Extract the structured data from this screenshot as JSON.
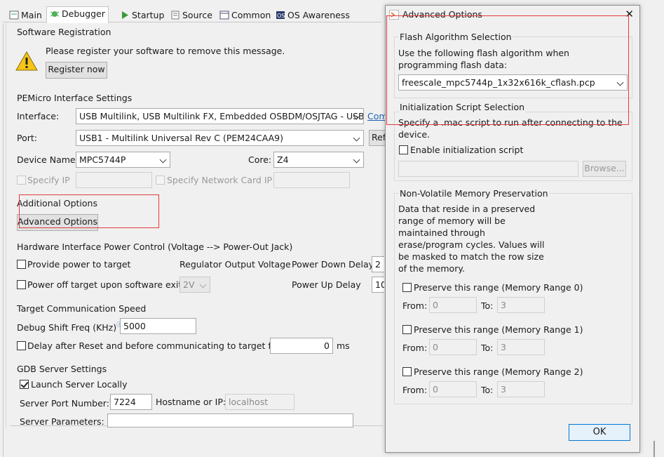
{
  "tabs": [
    {
      "label": "Main",
      "icon": "main-tab-icon"
    },
    {
      "label": "Debugger",
      "icon": "debugger-tab-icon"
    },
    {
      "label": "Startup",
      "icon": "startup-tab-icon"
    },
    {
      "label": "Source",
      "icon": "source-tab-icon"
    },
    {
      "label": "Common",
      "icon": "common-tab-icon"
    },
    {
      "label": "OS Awareness",
      "icon": "os-awareness-tab-icon"
    }
  ],
  "registration": {
    "title": "Software Registration",
    "message": "Please register your software to remove this message.",
    "button": "Register now"
  },
  "pemicro": {
    "title": "PEMicro Interface Settings",
    "interface_label": "Interface:",
    "interface_value": "USB Multilink, USB Multilink FX, Embedded OSBDM/OSJTAG - USB",
    "compare_link": "Com",
    "port_label": "Port:",
    "port_value": "USB1 - Multilink Universal Rev C (PEM24CAA9)",
    "refresh_button": "Ref",
    "device_label": "Device Name:",
    "device_value": "MPC5744P",
    "core_label": "Core:",
    "core_value": "Z4",
    "specify_ip_label": "Specify IP",
    "specify_nic_label": "Specify Network Card IP"
  },
  "additional": {
    "title": "Additional Options",
    "button": "Advanced Options"
  },
  "power": {
    "title": "Hardware Interface Power Control (Voltage --> Power-Out Jack)",
    "provide_power_label": "Provide power to target",
    "regulator_label": "Regulator Output Voltage",
    "power_down_label": "Power Down Delay",
    "power_down_value": "2",
    "power_off_label": "Power off target upon software exit",
    "voltage_value": "2V",
    "power_up_label": "Power Up Delay",
    "power_up_value": "10"
  },
  "speed": {
    "title": "Target Communication Speed",
    "shift_label": "Debug Shift Freq (KHz)",
    "shift_value": "5000",
    "delay_label": "Delay after Reset and before communicating to target for",
    "delay_value": "0",
    "delay_unit": "ms"
  },
  "gdb": {
    "title": "GDB Server Settings",
    "launch_label": "Launch Server Locally",
    "port_label": "Server Port Number:",
    "port_value": "7224",
    "hostname_label": "Hostname or IP:",
    "hostname_value": "localhost",
    "params_label": "Server Parameters:"
  },
  "dialog": {
    "title": "Advanced Options",
    "close": "✕",
    "flash": {
      "title": "Flash Algorithm Selection",
      "desc_line1": "Use the following flash algorithm when",
      "desc_line2": "programming flash data:",
      "algorithm_value": "freescale_mpc5744p_1x32x616k_cflash.pcp"
    },
    "init": {
      "title": "Initialization Script Selection",
      "desc_line1": "Specify a .mac script to run after connecting to the",
      "desc_line2": "device.",
      "enable_label": "Enable initialization script",
      "browse_button": "Browse..."
    },
    "nvm": {
      "title": "Non-Volatile Memory Preservation",
      "desc": [
        "Data that reside in a preserved",
        "range of memory will be",
        "maintained through",
        "erase/program cycles. Values will",
        "be masked to match the row size",
        "of the memory."
      ],
      "ranges": [
        {
          "label": "Preserve this range (Memory Range 0)",
          "from_label": "From:",
          "from_value": "0",
          "to_label": "To:",
          "to_value": "3"
        },
        {
          "label": "Preserve this range (Memory Range 1)",
          "from_label": "From:",
          "from_value": "0",
          "to_label": "To:",
          "to_value": "3"
        },
        {
          "label": "Preserve this range (Memory Range 2)",
          "from_label": "From:",
          "from_value": "0",
          "to_label": "To:",
          "to_value": "3"
        }
      ]
    },
    "ok_button": "OK"
  },
  "colors": {
    "highlight_box": "#e23b3b",
    "link": "#1a5fb4",
    "ok_border": "#0078d7"
  }
}
